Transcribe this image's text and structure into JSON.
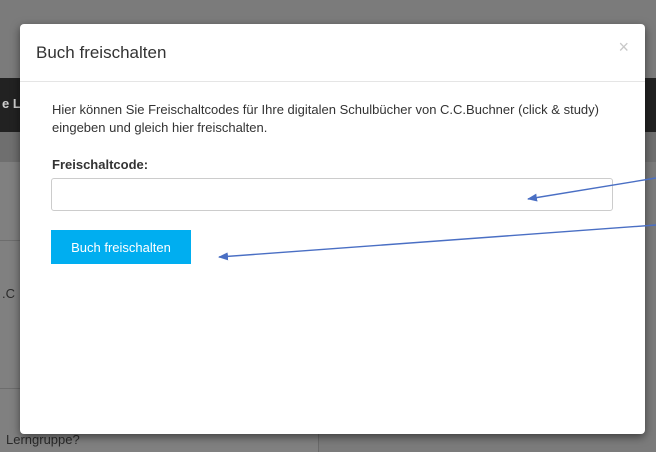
{
  "background": {
    "header_fragment": "e L",
    "list_fragment": ".C",
    "bottom_fragment": "Lerngruppe?"
  },
  "modal": {
    "title": "Buch freischalten",
    "close_symbol": "×",
    "intro_text": "Hier können Sie Freischaltcodes für Ihre digitalen Schulbücher von C.C.Buchner (click & study) eingeben und gleich hier freischalten.",
    "field_label": "Freischaltcode:",
    "code_value": "",
    "submit_label": "Buch freischalten"
  },
  "colors": {
    "accent": "#00aef0",
    "annotation_arrow": "#4a6fc4",
    "backdrop": "#7b7b7b"
  },
  "annotations": {
    "arrow_count": 2
  }
}
